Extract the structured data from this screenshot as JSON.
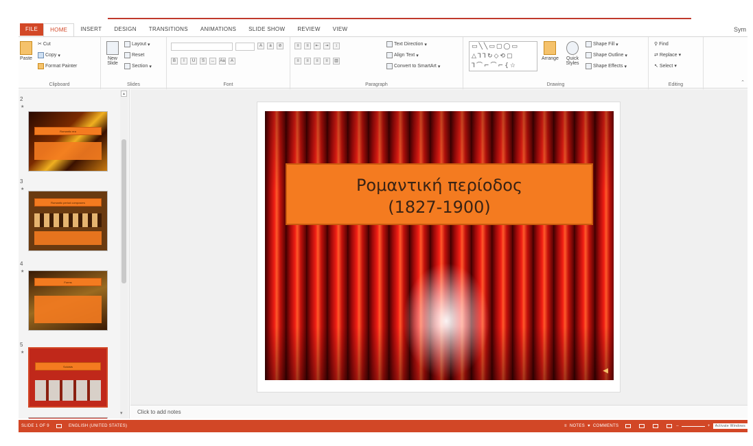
{
  "tabs": [
    "FILE",
    "HOME",
    "INSERT",
    "DESIGN",
    "TRANSITIONS",
    "ANIMATIONS",
    "SLIDE SHOW",
    "REVIEW",
    "VIEW"
  ],
  "active_tab": "HOME",
  "user": "Sym",
  "ribbon": {
    "clipboard": {
      "paste": "Paste",
      "cut": "Cut",
      "copy": "Copy",
      "format_painter": "Format Painter",
      "label": "Clipboard"
    },
    "slides": {
      "new_slide": "New Slide",
      "layout": "Layout",
      "reset": "Reset",
      "section": "Section",
      "label": "Slides"
    },
    "font": {
      "label": "Font"
    },
    "paragraph": {
      "text_direction": "Text Direction",
      "align_text": "Align Text",
      "convert_smartart": "Convert to SmartArt",
      "label": "Paragraph"
    },
    "drawing": {
      "arrange": "Arrange",
      "quick_styles": "Quick Styles",
      "shape_fill": "Shape Fill",
      "shape_outline": "Shape Outline",
      "shape_effects": "Shape Effects",
      "label": "Drawing"
    },
    "editing": {
      "find": "Find",
      "replace": "Replace",
      "select": "Select",
      "label": "Editing"
    }
  },
  "thumbnails": [
    {
      "num": "2",
      "title": "Romantic era"
    },
    {
      "num": "3",
      "title": "Romantic period composers"
    },
    {
      "num": "4",
      "title": "Forms"
    },
    {
      "num": "5",
      "title": "Soloists"
    }
  ],
  "slide": {
    "title_line1": "Ρομαντική περίοδος",
    "title_line2": "(1827-1900)"
  },
  "notes_placeholder": "Click to add notes",
  "status": {
    "slide_info": "SLIDE 1 OF 9",
    "language": "ENGLISH (UNITED STATES)",
    "notes": "NOTES",
    "comments": "COMMENTS",
    "zoom": "Activate Windows"
  },
  "colors": {
    "accent": "#d24726",
    "title_box": "#f47b20"
  }
}
